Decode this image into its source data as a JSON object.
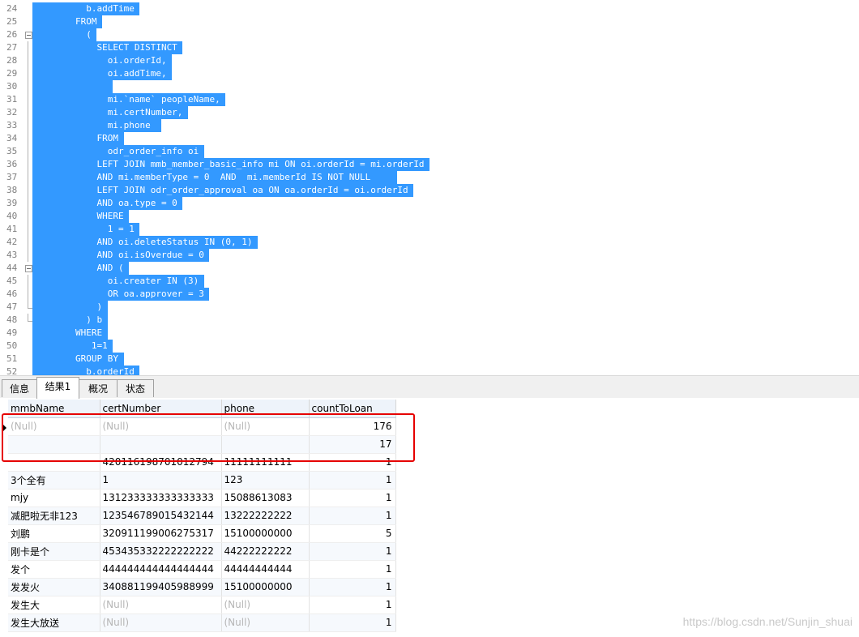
{
  "editor": {
    "lines": [
      {
        "n": "24",
        "text": "          b.addTime "
      },
      {
        "n": "25",
        "text": "        FROM "
      },
      {
        "n": "26",
        "text": "          ( "
      },
      {
        "n": "27",
        "text": "            SELECT DISTINCT "
      },
      {
        "n": "28",
        "text": "              oi.orderId, "
      },
      {
        "n": "29",
        "text": "              oi.addTime, "
      },
      {
        "n": "30",
        "text": "               "
      },
      {
        "n": "31",
        "text": "              mi.`name` peopleName, "
      },
      {
        "n": "32",
        "text": "              mi.certNumber, "
      },
      {
        "n": "33",
        "text": "              mi.phone  "
      },
      {
        "n": "34",
        "text": "            FROM "
      },
      {
        "n": "35",
        "text": "              odr_order_info oi "
      },
      {
        "n": "36",
        "text": "            LEFT JOIN mmb_member_basic_info mi ON oi.orderId = mi.orderId "
      },
      {
        "n": "37",
        "text": "            AND mi.memberType = 0  AND  mi.memberId IS NOT NULL     "
      },
      {
        "n": "38",
        "text": "            LEFT JOIN odr_order_approval oa ON oa.orderId = oi.orderId "
      },
      {
        "n": "39",
        "text": "            AND oa.type = 0 "
      },
      {
        "n": "40",
        "text": "            WHERE "
      },
      {
        "n": "41",
        "text": "              1 = 1 "
      },
      {
        "n": "42",
        "text": "            AND oi.deleteStatus IN (0, 1) "
      },
      {
        "n": "43",
        "text": "            AND oi.isOverdue = 0 "
      },
      {
        "n": "44",
        "text": "            AND ( "
      },
      {
        "n": "45",
        "text": "              oi.creater IN (3) "
      },
      {
        "n": "46",
        "text": "              OR oa.approver = 3 "
      },
      {
        "n": "47",
        "text": "            ) "
      },
      {
        "n": "48",
        "text": "          ) b "
      },
      {
        "n": "49",
        "text": "        WHERE "
      },
      {
        "n": "50",
        "text": "           1=1 "
      },
      {
        "n": "51",
        "text": "        GROUP BY "
      },
      {
        "n": "52",
        "text": "          b.orderId "
      }
    ]
  },
  "tabs": [
    {
      "label": "信息",
      "active": false
    },
    {
      "label": "结果1",
      "active": true
    },
    {
      "label": "概况",
      "active": false
    },
    {
      "label": "状态",
      "active": false
    }
  ],
  "grid": {
    "columns": [
      "mmbName",
      "certNumber",
      "phone",
      "countToLoan"
    ],
    "rows": [
      {
        "name": "(Null)",
        "cert": "(Null)",
        "phone": "(Null)",
        "count": "176"
      },
      {
        "name": "",
        "cert": "",
        "phone": "",
        "count": "17"
      },
      {
        "name": "",
        "cert": "420116198701012794",
        "phone": "11111111111",
        "count": "1"
      },
      {
        "name": "3个全有",
        "cert": "1",
        "phone": "123",
        "count": "1"
      },
      {
        "name": "mjy",
        "cert": "131233333333333333",
        "phone": "15088613083",
        "count": "1"
      },
      {
        "name": "减肥啦无非123",
        "cert": "123546789015432144",
        "phone": "13222222222",
        "count": "1"
      },
      {
        "name": "刘鹏",
        "cert": "320911199006275317",
        "phone": "15100000000",
        "count": "5"
      },
      {
        "name": "刚卡是个",
        "cert": "453435332222222222",
        "phone": "44222222222",
        "count": "1"
      },
      {
        "name": "发个",
        "cert": "444444444444444444",
        "phone": "44444444444",
        "count": "1"
      },
      {
        "name": "发发火",
        "cert": "340881199405988999",
        "phone": "15100000000",
        "count": "1"
      },
      {
        "name": "发生大",
        "cert": "(Null)",
        "phone": "(Null)",
        "count": "1"
      },
      {
        "name": "发生大放送",
        "cert": "(Null)",
        "phone": "(Null)",
        "count": "1"
      }
    ],
    "null_text": "(Null)"
  },
  "watermark": "https://blog.csdn.net/Sunjin_shuai",
  "colors": {
    "selection": "#3399ff",
    "highlight_box": "#e60000",
    "null_text": "#b5b5b5"
  }
}
